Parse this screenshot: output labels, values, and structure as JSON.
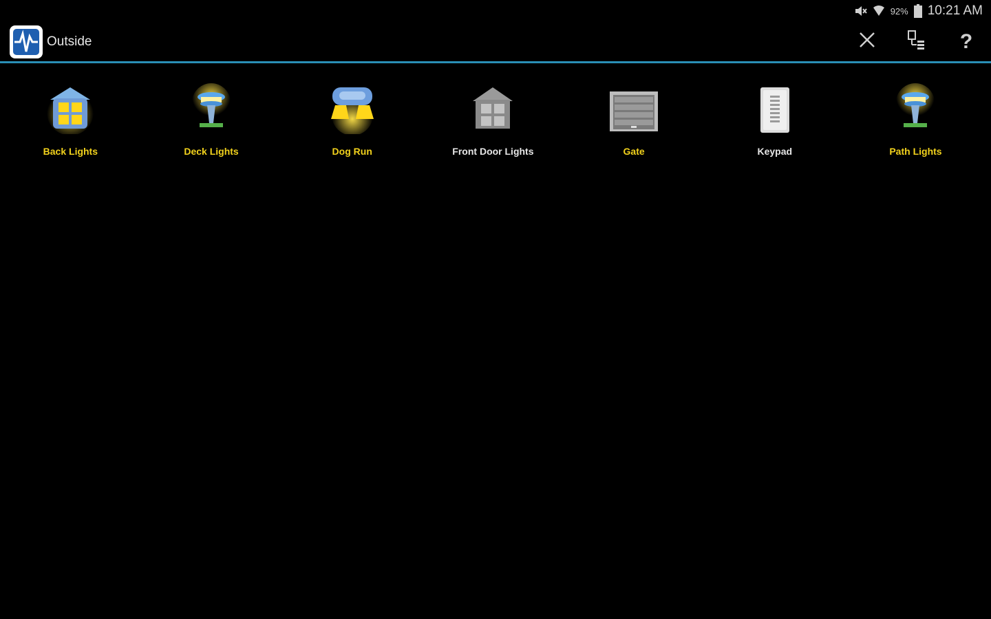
{
  "status_bar": {
    "battery_percent": "92%",
    "time": "10:21 AM",
    "icons": [
      "mute-icon",
      "wifi-icon",
      "battery-icon"
    ]
  },
  "header": {
    "title": "Outside",
    "logo_icon": "app-logo-icon",
    "actions": [
      {
        "name": "close-button",
        "icon": "close-icon"
      },
      {
        "name": "device-list-button",
        "icon": "device-list-icon"
      },
      {
        "name": "help-button",
        "icon": "help-icon",
        "label": "?"
      }
    ],
    "accent_color": "#2a8fb6"
  },
  "devices": [
    {
      "label": "Back Lights",
      "icon": "house-light-icon",
      "state": "on"
    },
    {
      "label": "Deck Lights",
      "icon": "lamp-post-icon",
      "state": "on"
    },
    {
      "label": "Dog Run",
      "icon": "floodlight-icon",
      "state": "on"
    },
    {
      "label": "Front Door Lights",
      "icon": "house-light-icon",
      "state": "off"
    },
    {
      "label": "Gate",
      "icon": "garage-gate-icon",
      "state": "on"
    },
    {
      "label": "Keypad",
      "icon": "keypad-icon",
      "state": "off"
    },
    {
      "label": "Path Lights",
      "icon": "lamp-post-icon",
      "state": "on"
    }
  ],
  "colors": {
    "background": "#000000",
    "on_label": "#f2d21c",
    "off_label": "#e6e6e6"
  }
}
